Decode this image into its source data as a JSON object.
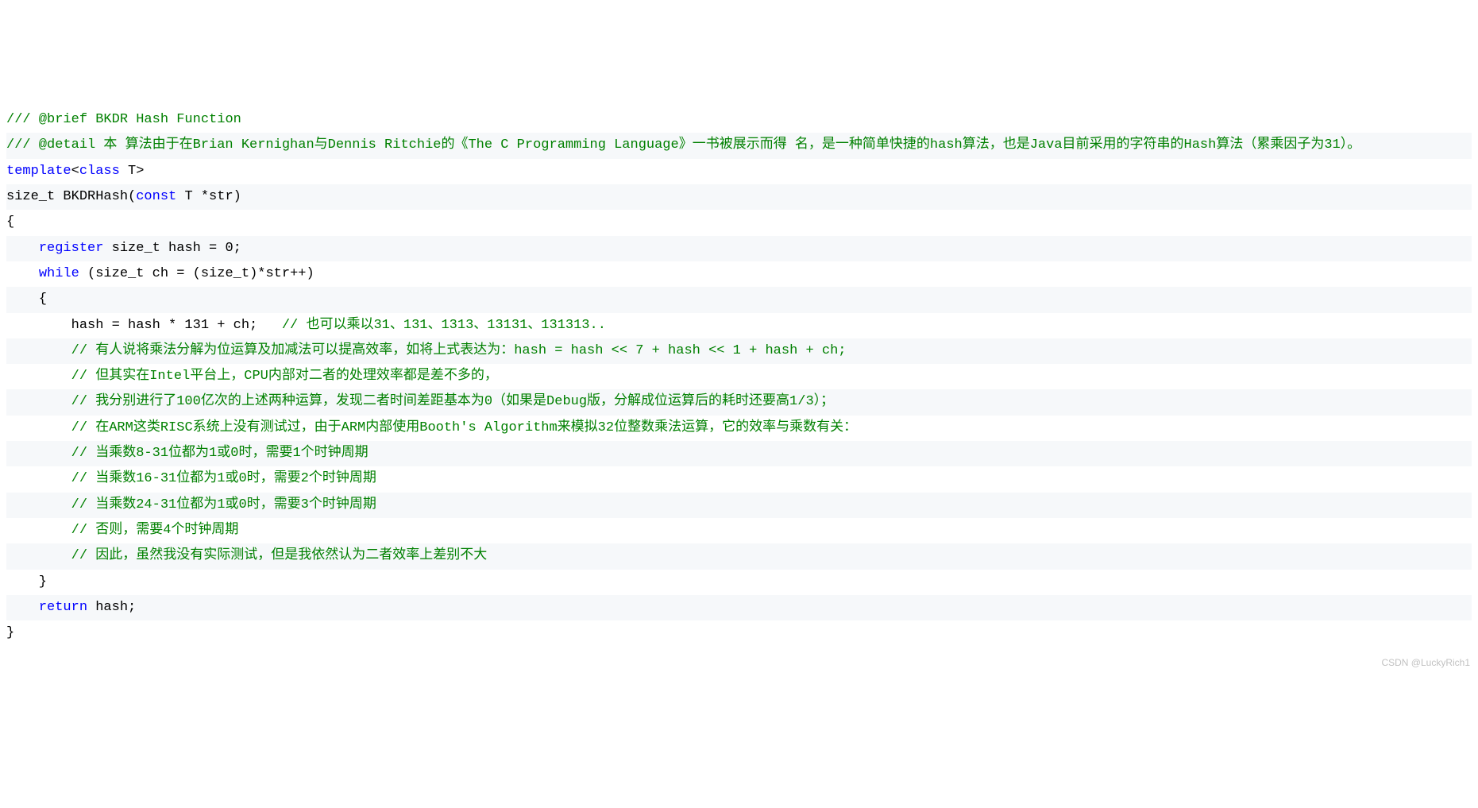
{
  "lines": [
    [
      {
        "cls": "comment",
        "text": "/// @brief BKDR Hash Function"
      }
    ],
    [
      {
        "cls": "comment",
        "text": "/// @detail 本 算法由于在Brian Kernighan与Dennis Ritchie的《The C Programming Language》一书被展示而得 名，是一种简单快捷的hash算法，也是Java目前采用的字符串的Hash算法（累乘因子为31）。"
      }
    ],
    [
      {
        "cls": "keyword",
        "text": "template"
      },
      {
        "cls": "plain",
        "text": "<"
      },
      {
        "cls": "keyword",
        "text": "class"
      },
      {
        "cls": "plain",
        "text": " T>"
      }
    ],
    [
      {
        "cls": "plain",
        "text": "size_t BKDRHash("
      },
      {
        "cls": "keyword",
        "text": "const"
      },
      {
        "cls": "plain",
        "text": " T *str)"
      }
    ],
    [
      {
        "cls": "plain",
        "text": "{"
      }
    ],
    [
      {
        "cls": "plain",
        "text": "    "
      },
      {
        "cls": "keyword",
        "text": "register"
      },
      {
        "cls": "plain",
        "text": " size_t hash = 0;"
      }
    ],
    [
      {
        "cls": "plain",
        "text": "    "
      },
      {
        "cls": "keyword",
        "text": "while"
      },
      {
        "cls": "plain",
        "text": " (size_t ch = (size_t)*str++)"
      }
    ],
    [
      {
        "cls": "plain",
        "text": "    {"
      }
    ],
    [
      {
        "cls": "plain",
        "text": "        hash = hash * 131 + ch;   "
      },
      {
        "cls": "comment",
        "text": "// 也可以乘以31、131、1313、13131、131313.."
      }
    ],
    [
      {
        "cls": "plain",
        "text": "        "
      },
      {
        "cls": "comment",
        "text": "// 有人说将乘法分解为位运算及加减法可以提高效率，如将上式表达为：hash = hash << 7 + hash << 1 + hash + ch;"
      }
    ],
    [
      {
        "cls": "plain",
        "text": "        "
      },
      {
        "cls": "comment",
        "text": "// 但其实在Intel平台上，CPU内部对二者的处理效率都是差不多的，"
      }
    ],
    [
      {
        "cls": "plain",
        "text": "        "
      },
      {
        "cls": "comment",
        "text": "// 我分别进行了100亿次的上述两种运算，发现二者时间差距基本为0（如果是Debug版，分解成位运算后的耗时还要高1/3）；"
      }
    ],
    [
      {
        "cls": "plain",
        "text": "        "
      },
      {
        "cls": "comment",
        "text": "// 在ARM这类RISC系统上没有测试过，由于ARM内部使用Booth's Algorithm来模拟32位整数乘法运算，它的效率与乘数有关："
      }
    ],
    [
      {
        "cls": "plain",
        "text": "        "
      },
      {
        "cls": "comment",
        "text": "// 当乘数8-31位都为1或0时，需要1个时钟周期"
      }
    ],
    [
      {
        "cls": "plain",
        "text": "        "
      },
      {
        "cls": "comment",
        "text": "// 当乘数16-31位都为1或0时，需要2个时钟周期"
      }
    ],
    [
      {
        "cls": "plain",
        "text": "        "
      },
      {
        "cls": "comment",
        "text": "// 当乘数24-31位都为1或0时，需要3个时钟周期"
      }
    ],
    [
      {
        "cls": "plain",
        "text": "        "
      },
      {
        "cls": "comment",
        "text": "// 否则，需要4个时钟周期"
      }
    ],
    [
      {
        "cls": "plain",
        "text": "        "
      },
      {
        "cls": "comment",
        "text": "// 因此，虽然我没有实际测试，但是我依然认为二者效率上差别不大"
      }
    ],
    [
      {
        "cls": "plain",
        "text": "    }"
      }
    ],
    [
      {
        "cls": "plain",
        "text": "    "
      },
      {
        "cls": "keyword",
        "text": "return"
      },
      {
        "cls": "plain",
        "text": " hash;"
      }
    ],
    [
      {
        "cls": "plain",
        "text": "}"
      }
    ]
  ],
  "watermark": "CSDN @LuckyRich1"
}
